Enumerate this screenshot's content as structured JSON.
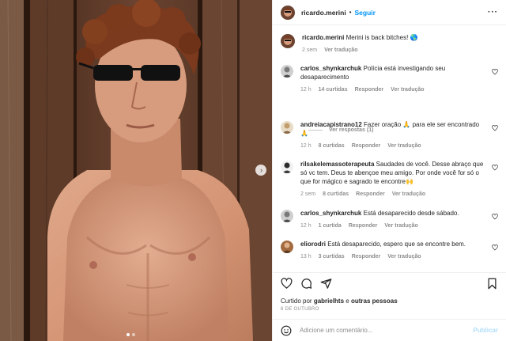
{
  "post": {
    "author": "ricardo.merini",
    "separator": "•",
    "follow_label": "Seguir",
    "more_label": "···",
    "caption_text": "Merini is back bitches! 🌎",
    "caption_time": "2 sem",
    "caption_translate": "Ver tradução"
  },
  "comments": [
    {
      "user": "carlos_shynkarchuk",
      "text": "Polícia está investigando seu desaparecimento",
      "time": "12 h",
      "likes": "14 curtidas",
      "reply": "Responder",
      "translate": "Ver tradução"
    },
    {
      "user": "andreiacapistrano12",
      "text": "Fazer oração 🙏 para ele ser encontrado 🙏",
      "time": "12 h",
      "likes": "8 curtidas",
      "reply": "Responder",
      "translate": "Ver tradução"
    },
    {
      "user": "rilsakelemassoterapeuta",
      "text": "Saudades de você. Desse abraço que só vc tem. Deus te abençoe meu amigo. Por onde você for só o que for mágico e sagrado te encontre🙌",
      "time": "2 sem",
      "likes": "8 curtidas",
      "reply": "Responder",
      "translate": "Ver tradução"
    },
    {
      "user": "carlos_shynkarchuk",
      "text": "Está desaparecido desde sábado.",
      "time": "12 h",
      "likes": "1 curtida",
      "reply": "Responder",
      "translate": "Ver tradução"
    },
    {
      "user": "eliorodri",
      "text": "Está desaparecido, espero que se encontre bem.",
      "time": "13 h",
      "likes": "3 curtidas",
      "reply": "Responder",
      "translate": "Ver tradução"
    }
  ],
  "view_replies": "Ver respostas (1)",
  "likes": {
    "prefix": "Curtido por",
    "user": "gabrielhts",
    "connector": "e",
    "others": "outras pessoas"
  },
  "date": "6 DE OUTUBRO",
  "add_comment": {
    "placeholder": "Adicione um comentário...",
    "publish": "Publicar"
  },
  "icons": [
    "heart-icon",
    "comment-icon",
    "share-icon",
    "bookmark-icon",
    "emoji-icon",
    "chevron-right-icon"
  ],
  "colors": {
    "link": "#0095f6",
    "muted": "#8e8e8e",
    "publish_disabled": "#b2dffc"
  }
}
